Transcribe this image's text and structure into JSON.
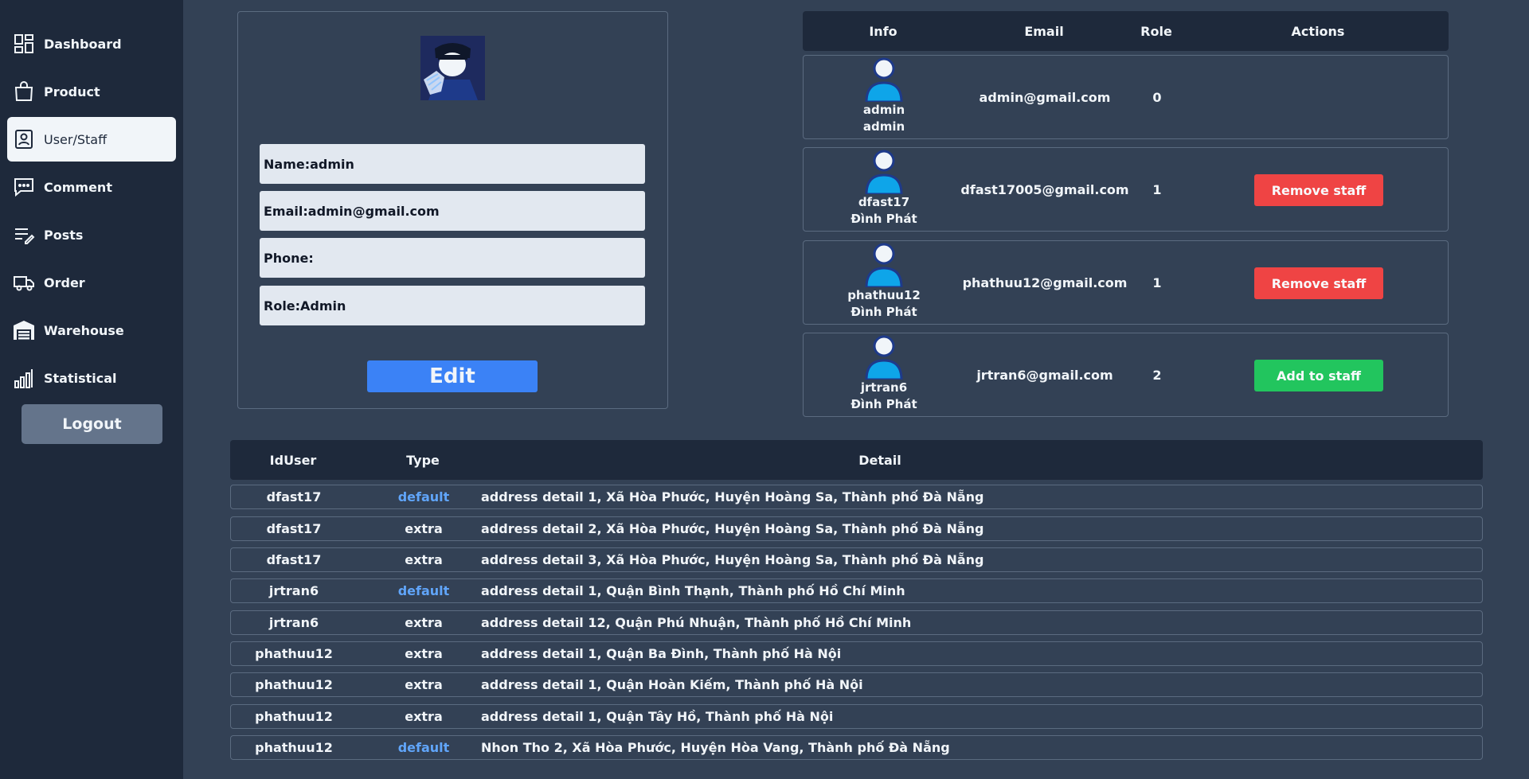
{
  "sidebar": {
    "items": [
      {
        "label": "Dashboard",
        "icon": "dashboard-icon"
      },
      {
        "label": "Product",
        "icon": "shopping-bag-icon"
      },
      {
        "label": "User/Staff",
        "icon": "user-badge-icon",
        "active": true
      },
      {
        "label": "Comment",
        "icon": "comment-icon"
      },
      {
        "label": "Posts",
        "icon": "posts-icon"
      },
      {
        "label": "Order",
        "icon": "truck-icon"
      },
      {
        "label": "Warehouse",
        "icon": "warehouse-icon"
      },
      {
        "label": "Statistical",
        "icon": "bar-chart-icon"
      }
    ],
    "logout_label": "Logout"
  },
  "profile": {
    "name": "Name:admin",
    "email": "Email:admin@gmail.com",
    "phone": "Phone:",
    "role": "Role:Admin",
    "edit_label": "Edit"
  },
  "users_table": {
    "headers": {
      "info": "Info",
      "email": "Email",
      "role": "Role",
      "actions": "Actions"
    },
    "rows": [
      {
        "username": "admin",
        "display_name": "admin",
        "email": "admin@gmail.com",
        "role": "0",
        "action": ""
      },
      {
        "username": "dfast17",
        "display_name": "Đình Phát",
        "email": "dfast17005@gmail.com",
        "role": "1",
        "action": "Remove staff"
      },
      {
        "username": "phathuu12",
        "display_name": "Đình Phát",
        "email": "phathuu12@gmail.com",
        "role": "1",
        "action": "Remove staff"
      },
      {
        "username": "jrtran6",
        "display_name": "Đình Phát",
        "email": "jrtran6@gmail.com",
        "role": "2",
        "action": "Add to staff"
      }
    ]
  },
  "address_table": {
    "headers": {
      "id": "IdUser",
      "type": "Type",
      "detail": "Detail"
    },
    "rows": [
      {
        "id": "dfast17",
        "type": "default",
        "detail": "address detail 1, Xã Hòa Phước, Huyện Hoàng Sa, Thành phố Đà Nẵng"
      },
      {
        "id": "dfast17",
        "type": "extra",
        "detail": "address detail 2, Xã Hòa Phước, Huyện Hoàng Sa, Thành phố Đà Nẵng"
      },
      {
        "id": "dfast17",
        "type": "extra",
        "detail": "address detail 3, Xã Hòa Phước, Huyện Hoàng Sa, Thành phố Đà Nẵng"
      },
      {
        "id": "jrtran6",
        "type": "default",
        "detail": "address detail 1, Quận Bình Thạnh, Thành phố Hồ Chí Minh"
      },
      {
        "id": "jrtran6",
        "type": "extra",
        "detail": "address detail 12, Quận Phú Nhuận, Thành phố Hồ Chí Minh"
      },
      {
        "id": "phathuu12",
        "type": "extra",
        "detail": "address detail 1, Quận Ba Đình, Thành phố Hà Nội"
      },
      {
        "id": "phathuu12",
        "type": "extra",
        "detail": "address detail 1, Quận Hoàn Kiếm, Thành phố Hà Nội"
      },
      {
        "id": "phathuu12",
        "type": "extra",
        "detail": "address detail 1, Quận Tây Hồ, Thành phố Hà Nội"
      },
      {
        "id": "phathuu12",
        "type": "default",
        "detail": "Nhon Tho 2, Xã Hòa Phước, Huyện Hòa Vang, Thành phố Đà Nẵng"
      }
    ]
  },
  "colors": {
    "sidebar_bg": "#1e293b",
    "page_bg": "#334155",
    "accent_blue": "#3b82f6",
    "remove_red": "#ef4444",
    "add_green": "#22c55e",
    "default_type": "#60a5fa"
  }
}
